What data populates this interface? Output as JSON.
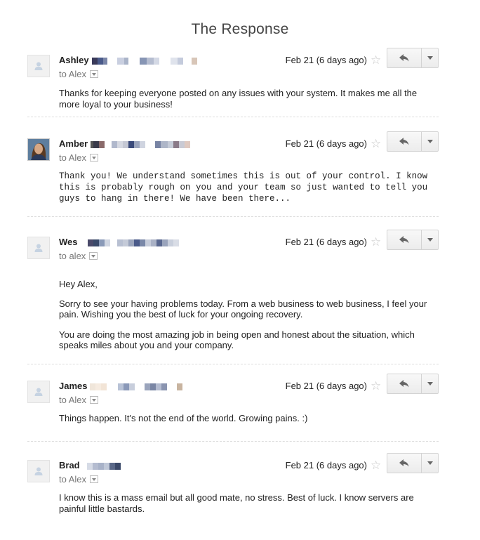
{
  "page_title": "The Response",
  "messages": [
    {
      "sender": "Ashley",
      "to": "to Alex",
      "date": "Feb 21 (6 days ago)",
      "avatar": "person-placeholder",
      "body": [
        "Thanks for keeping everyone posted on any issues with your system. It makes me all the more loyal to your business!"
      ]
    },
    {
      "sender": "Amber",
      "to": "to Alex",
      "date": "Feb 21 (6 days ago)",
      "avatar": "photo",
      "body": [
        "Thank you! We understand sometimes this is out of your control. I know this is probably rough on you and your team so just wanted to tell you guys to hang in there! We have been there..."
      ]
    },
    {
      "sender": "Wes",
      "to": "to alex",
      "date": "Feb 21 (6 days ago)",
      "avatar": "person-placeholder",
      "body": [
        "Hey Alex,",
        "Sorry to see your having problems today.  From a web business to web business, I feel your pain.  Wishing you the best of luck for your ongoing recovery.",
        "You are doing the most amazing job in being open and honest about the situation, which speaks miles about you and your company."
      ]
    },
    {
      "sender": "James",
      "to": "to Alex",
      "date": "Feb 21 (6 days ago)",
      "avatar": "person-placeholder",
      "body": [
        "Things happen. It's not the end of the world. Growing pains. :)"
      ]
    },
    {
      "sender": "Brad",
      "to": "to Alex",
      "date": "Feb 21 (6 days ago)",
      "avatar": "person-placeholder",
      "body": [
        "I know this is a mass email but all good mate, no stress. Best of luck. I know servers are painful little bastards."
      ]
    }
  ],
  "icons": {
    "star": "star-icon",
    "reply": "reply-icon",
    "more": "chevron-down-icon"
  }
}
